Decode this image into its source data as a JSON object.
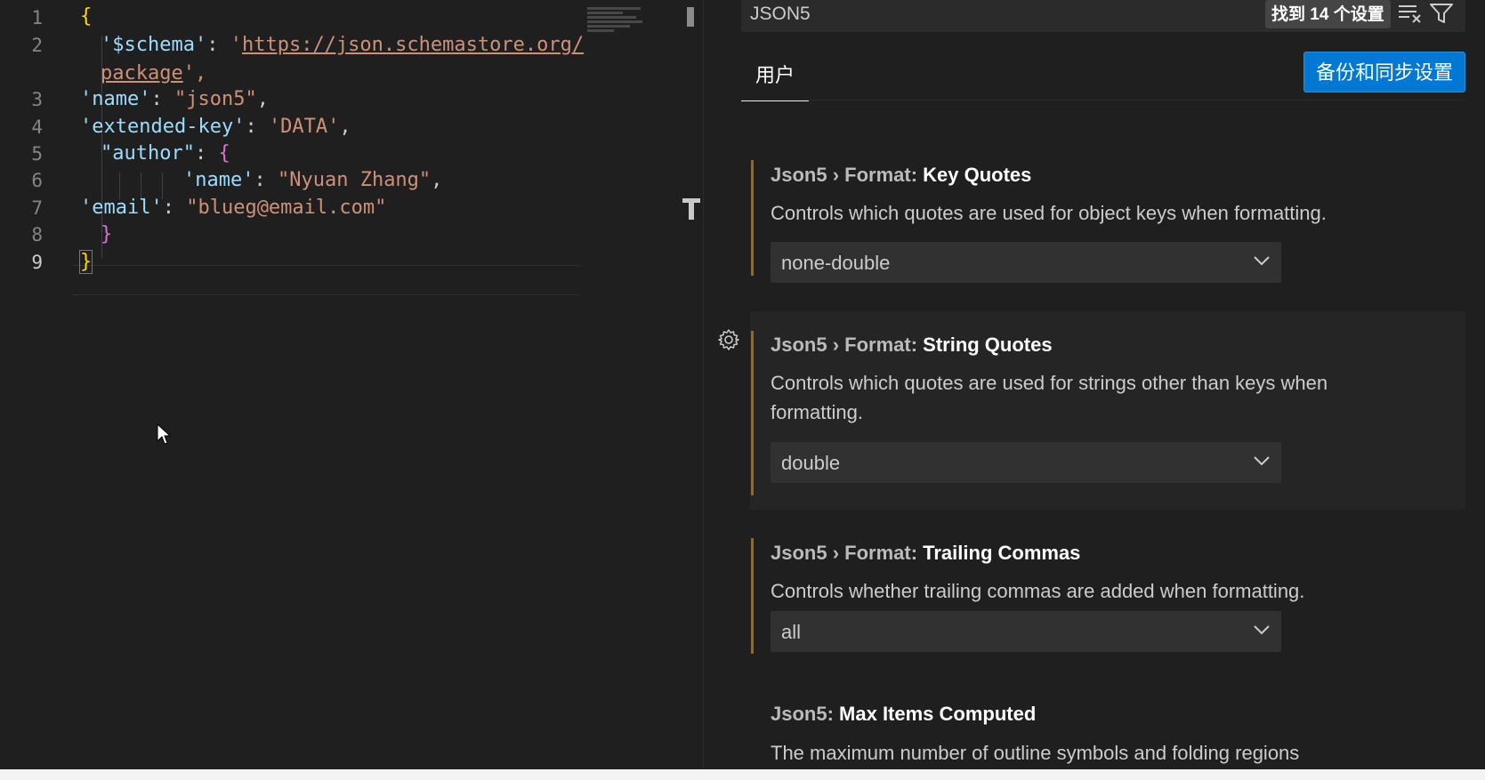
{
  "editor": {
    "line_numbers": [
      "1",
      "2",
      "3",
      "4",
      "5",
      "6",
      "7",
      "8",
      "9"
    ],
    "lines": {
      "l1_brace": "{",
      "l2_key": "'$schema'",
      "l2_colon": ": ",
      "l2_q": "'",
      "l2_url": "https://json.schemastore.org/",
      "l2b_url": "package",
      "l2b_end": "',",
      "l3_key": "'name'",
      "l3_colon": ": ",
      "l3_val": "\"json5\"",
      "l3_comma": ",",
      "l4_key": "'extended-key'",
      "l4_colon": ": ",
      "l4_val": "'DATA'",
      "l4_comma": ",",
      "l5_key": "\"author\"",
      "l5_colon": ": ",
      "l5_brace": "{",
      "l6_key": "'name'",
      "l6_colon": ": ",
      "l6_val": "\"Nyuan Zhang\"",
      "l6_comma": ",",
      "l7_key": "'email'",
      "l7_colon": ": ",
      "l7_val": "\"blueg@email.com\"",
      "l8_brace": "}",
      "l9_brace": "}"
    }
  },
  "settings": {
    "search_value": "JSON5",
    "results_count": "找到 14 个设置",
    "tab_user": "用户",
    "sync_button": "备份和同步设置",
    "items": [
      {
        "category": "Json5 › Format: ",
        "name": "Key Quotes",
        "description": "Controls which quotes are used for object keys when formatting.",
        "value": "none-double"
      },
      {
        "category": "Json5 › Format: ",
        "name": "String Quotes",
        "description": "Controls which quotes are used for strings other than keys when formatting.",
        "value": "double"
      },
      {
        "category": "Json5 › Format: ",
        "name": "Trailing Commas",
        "description": "Controls whether trailing commas are added when formatting.",
        "value": "all"
      },
      {
        "category": "Json5: ",
        "name": "Max Items Computed",
        "description": "The maximum number of outline symbols and folding regions"
      }
    ]
  },
  "colors": {
    "accent": "#0078d4",
    "background": "#1f1f1f",
    "string": "#ce9178",
    "key": "#9cdcfe",
    "bracket_gold": "#ffd700",
    "bracket_pink": "#da70d6"
  }
}
